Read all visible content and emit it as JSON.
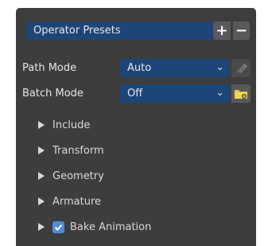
{
  "operator_presets": {
    "label": "Operator Presets",
    "add_label": "+",
    "remove_label": "−"
  },
  "path_mode": {
    "label": "Path Mode",
    "value": "Auto"
  },
  "batch_mode": {
    "label": "Batch Mode",
    "value": "Off"
  },
  "sections": {
    "include": "Include",
    "transform": "Transform",
    "geometry": "Geometry",
    "armature": "Armature",
    "bake_animation": "Bake Animation"
  },
  "bake_animation_checked": true,
  "colors": {
    "panel_bg": "#3d3d3d",
    "accent_blue": "#1e4577",
    "checkbox_blue": "#4f8fda",
    "folder_yellow": "#e8c43a"
  }
}
